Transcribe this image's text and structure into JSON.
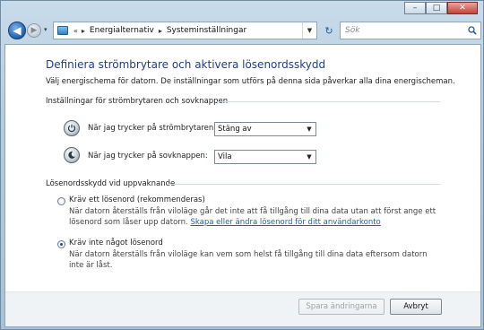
{
  "window": {
    "controls": [
      "–",
      "□",
      "✕"
    ]
  },
  "nav": {
    "back_icon": "back-arrow-icon",
    "forward_icon": "forward-arrow-icon",
    "history_glyph": "▾",
    "breadcrumb": [
      "Energialternativ",
      "Systeminställningar"
    ],
    "crumb_prefix": "«",
    "crumb_sep": "▸",
    "refresh_glyph": "↻",
    "search_placeholder": "Sök"
  },
  "main": {
    "title": "Definiera strömbrytare och aktivera lösenordsskydd",
    "subtitle": "Välj energischema för datorn. De inställningar som utförs på denna sida påverkar alla dina energischeman.",
    "buttons_section": {
      "heading": "Inställningar för strömbrytaren och sovknappen",
      "power_label": "När jag trycker på strömbrytaren:",
      "power_value": "Stäng av",
      "sleep_label": "När jag trycker på sovknappen:",
      "sleep_value": "Vila"
    },
    "password_section": {
      "heading": "Lösenordsskydd vid uppvaknande",
      "option1_label": "Kräv ett lösenord (rekommenderas)",
      "option1_desc": "När datorn återställs från viloläge går det inte att få tillgång till dina data utan att först ange ett lösenord som låser upp datorn.",
      "option1_link": "Skapa eller ändra lösenord för ditt användarkonto",
      "option2_label": "Kräv inte något lösenord",
      "option2_desc": "När datorn återställs från viloläge kan vem som helst få tillgång till dina data eftersom datorn inte är låst.",
      "selected": "option2"
    }
  },
  "footer": {
    "save_label": "Spara ändringarna",
    "cancel_label": "Avbryt"
  },
  "colors": {
    "title": "#1e3f8f",
    "link": "#1f5fc3"
  }
}
